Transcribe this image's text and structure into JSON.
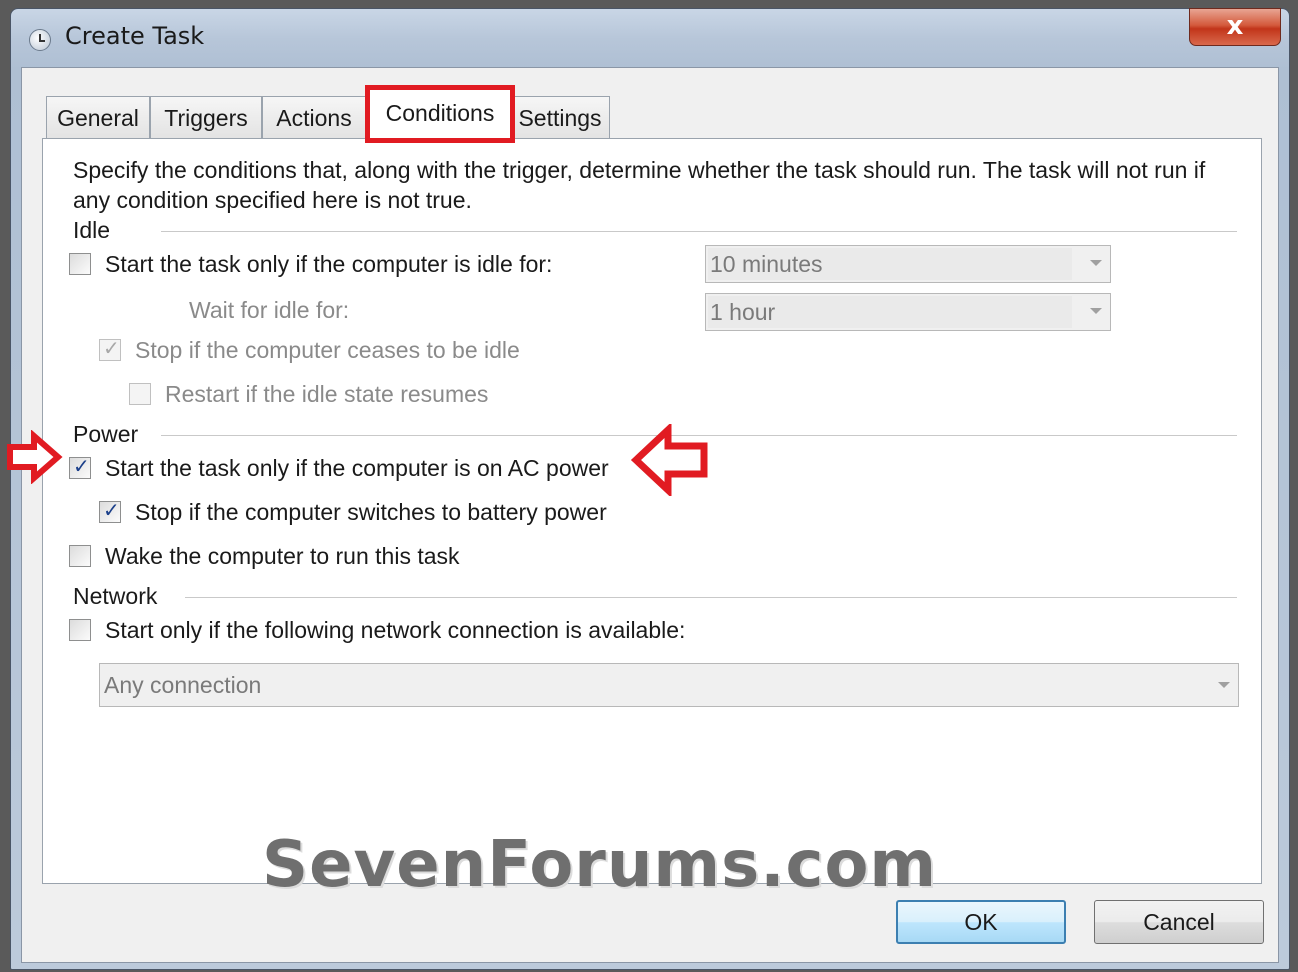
{
  "window": {
    "title": "Create Task",
    "close_label": "x"
  },
  "tabs": [
    "General",
    "Triggers",
    "Actions",
    "Conditions",
    "Settings"
  ],
  "active_tab": "Conditions",
  "description": "Specify the conditions that, along with the trigger, determine whether the task should run.  The task will not run  if any condition specified here is not true.",
  "idle": {
    "heading": "Idle",
    "start_if_idle": {
      "label": "Start the task only if the computer is idle for:",
      "checked": false
    },
    "idle_for_value": "10 minutes",
    "wait_label": "Wait for idle for:",
    "wait_value": "1 hour",
    "stop_if_not_idle": {
      "label": "Stop if the computer ceases to be idle",
      "checked": true,
      "disabled": true
    },
    "restart_if_idle": {
      "label": "Restart if the idle state resumes",
      "checked": false,
      "disabled": true
    }
  },
  "power": {
    "heading": "Power",
    "ac_power": {
      "label": "Start the task only if the computer is on AC power",
      "checked": true
    },
    "battery_stop": {
      "label": "Stop if the computer switches to battery power",
      "checked": true
    },
    "wake": {
      "label": "Wake the computer to run this task",
      "checked": false
    }
  },
  "network": {
    "heading": "Network",
    "start_if_network": {
      "label": "Start only if the following network connection is available:",
      "checked": false
    },
    "connection_value": "Any connection"
  },
  "buttons": {
    "ok": "OK",
    "cancel": "Cancel"
  },
  "watermark": "SevenForums.com",
  "colors": {
    "highlight_red": "#e11b22",
    "checkbox_mark": "#1a3f8a"
  }
}
